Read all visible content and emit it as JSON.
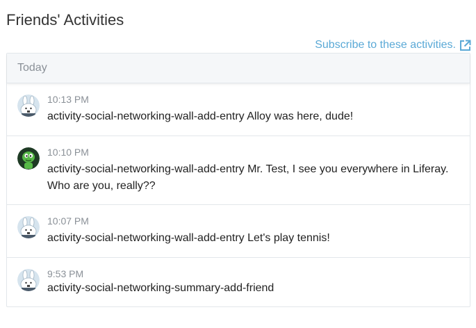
{
  "page": {
    "title": "Friends' Activities"
  },
  "subscribe": {
    "label": "Subscribe to these activities.",
    "icon": "external-link-icon"
  },
  "panel": {
    "header": "Today"
  },
  "activities": [
    {
      "time": "10:13 PM",
      "text": "activity-social-networking-wall-add-entry Alloy was here, dude!",
      "avatar": "bunny-avatar"
    },
    {
      "time": "10:10 PM",
      "text": "activity-social-networking-wall-add-entry Mr. Test, I see you everywhere in Liferay. Who are you, really??",
      "avatar": "alien-avatar"
    },
    {
      "time": "10:07 PM",
      "text": "activity-social-networking-wall-add-entry Let's play tennis!",
      "avatar": "bunny-avatar"
    },
    {
      "time": "9:53 PM",
      "text": "activity-social-networking-summary-add-friend",
      "avatar": "bunny-avatar"
    }
  ],
  "colors": {
    "link": "#5aa9d6",
    "header_bg": "#f5f7f9",
    "border": "#e2e6ea",
    "muted_text": "#8a9097"
  }
}
